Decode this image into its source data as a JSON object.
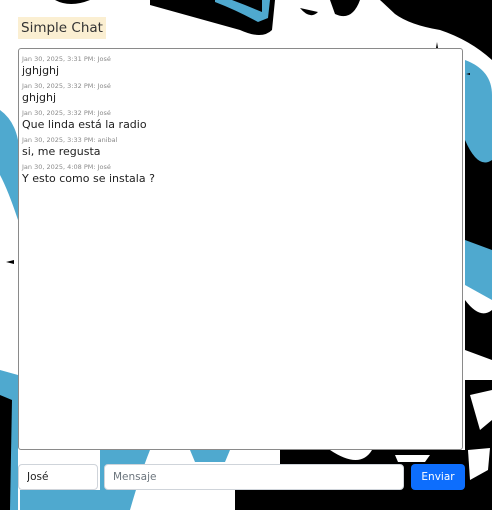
{
  "app": {
    "title": "Simple Chat"
  },
  "messages": [
    {
      "meta": "Jan 30, 2025, 3:31 PM: José",
      "text": "jghjghj"
    },
    {
      "meta": "Jan 30, 2025, 3:32 PM: José",
      "text": "ghjghj"
    },
    {
      "meta": "Jan 30, 2025, 3:32 PM: José",
      "text": "Que linda está la radio"
    },
    {
      "meta": "Jan 30, 2025, 3:33 PM: anibal",
      "text": "si, me regusta"
    },
    {
      "meta": "Jan 30, 2025, 4:08 PM: José",
      "text": "Y esto como se instala ?"
    }
  ],
  "composer": {
    "name_value": "José",
    "message_placeholder": "Mensaje",
    "send_label": "Enviar"
  },
  "colors": {
    "accent": "#0d6efd",
    "title_bg": "#fbefd2",
    "bg_blue": "#4fa9cf",
    "bg_dark": "#000000"
  }
}
